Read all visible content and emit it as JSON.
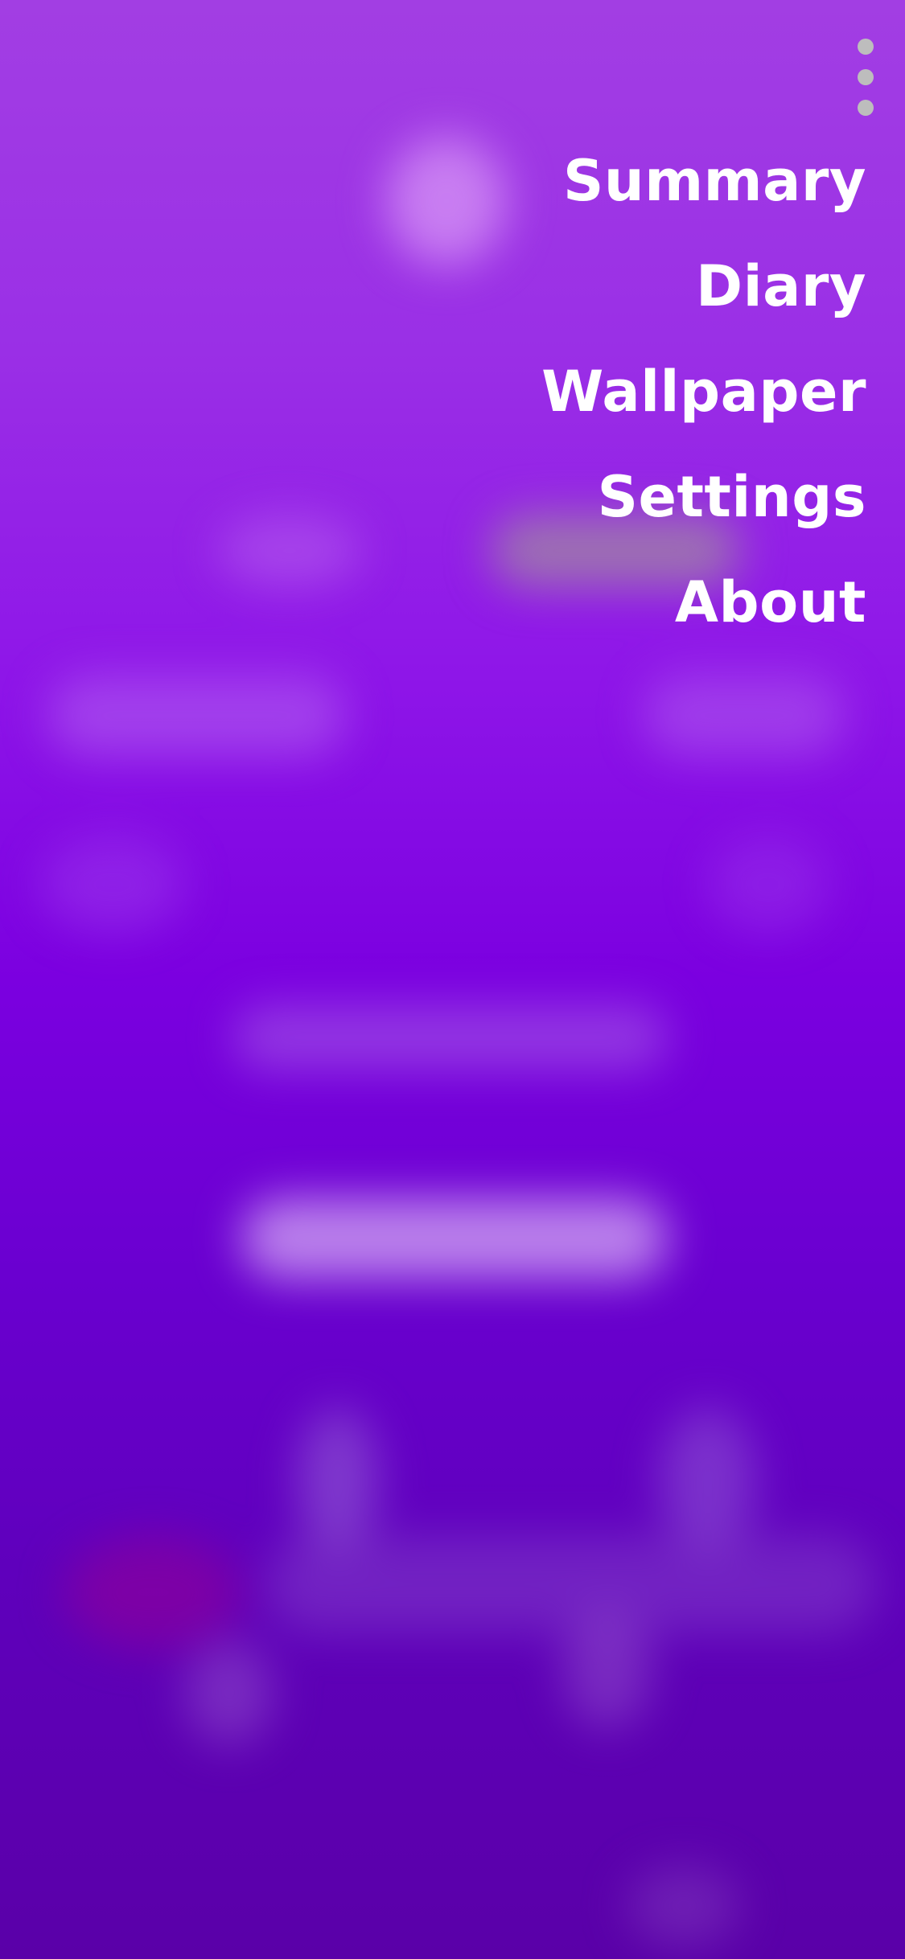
{
  "screen": {
    "background_top": "#a23ee3",
    "background_bottom": "#5a00a8"
  },
  "overflow_menu": {
    "icon": "more-vertical-icon",
    "dot_color": "#bdbdbd"
  },
  "menu": {
    "items": [
      {
        "label": "Summary"
      },
      {
        "label": "Diary"
      },
      {
        "label": "Wallpaper"
      },
      {
        "label": "Settings"
      },
      {
        "label": "About"
      }
    ],
    "text_color": "#ffffff"
  }
}
